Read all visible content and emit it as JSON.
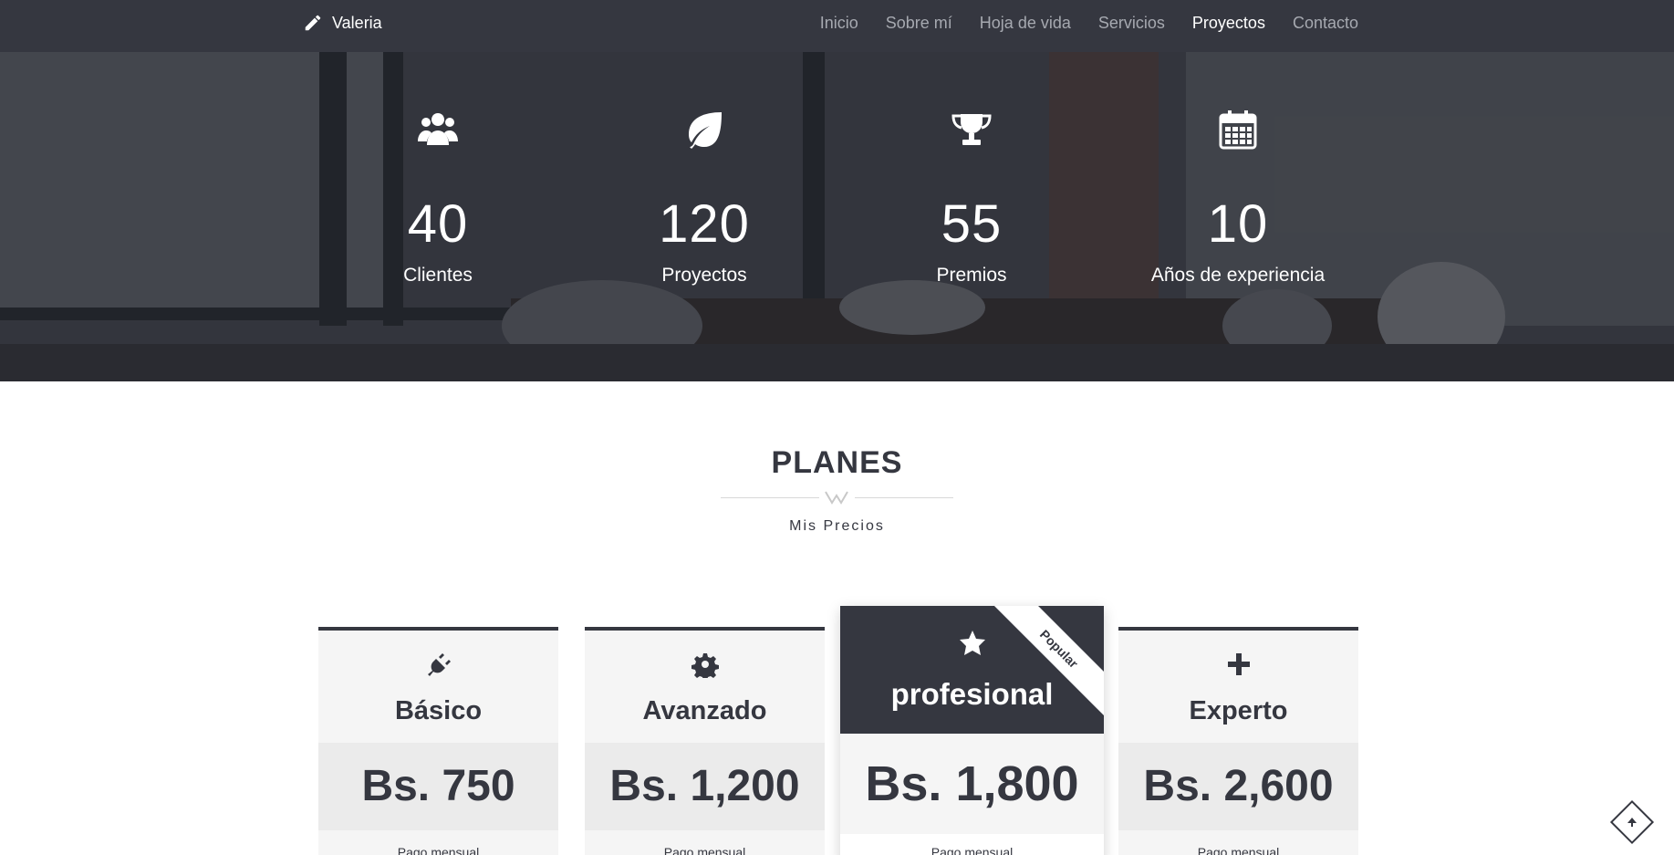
{
  "navbar": {
    "brand": "Valeria",
    "items": [
      {
        "label": "Inicio",
        "active": false
      },
      {
        "label": "Sobre mí",
        "active": false
      },
      {
        "label": "Hoja de vida",
        "active": false
      },
      {
        "label": "Servicios",
        "active": false
      },
      {
        "label": "Proyectos",
        "active": true
      },
      {
        "label": "Contacto",
        "active": false
      }
    ]
  },
  "stats": [
    {
      "icon": "users-icon",
      "value": "40",
      "label": "Clientes"
    },
    {
      "icon": "leaf-icon",
      "value": "120",
      "label": "Proyectos"
    },
    {
      "icon": "trophy-icon",
      "value": "55",
      "label": "Premios"
    },
    {
      "icon": "calendar-icon",
      "value": "10",
      "label": "Años de experiencia"
    }
  ],
  "section": {
    "title": "PLANES",
    "subtitle": "Mis Precios"
  },
  "plans": [
    {
      "icon": "plug-icon",
      "name": "Básico",
      "price": "Bs. 750",
      "period": "Pago mensual"
    },
    {
      "icon": "gear-icon",
      "name": "Avanzado",
      "price": "Bs. 1,200",
      "period": "Pago mensual"
    },
    {
      "icon": "star-icon",
      "name": "profesional",
      "price": "Bs. 1,800",
      "period": "Pago mensual",
      "ribbon": "Popular"
    },
    {
      "icon": "plus-icon",
      "name": "Experto",
      "price": "Bs. 2,600",
      "period": "Pago mensual"
    }
  ],
  "colors": {
    "primary": "#353740",
    "nav_inactive": "#a6a9b0",
    "card_bg": "#f5f5f5"
  }
}
